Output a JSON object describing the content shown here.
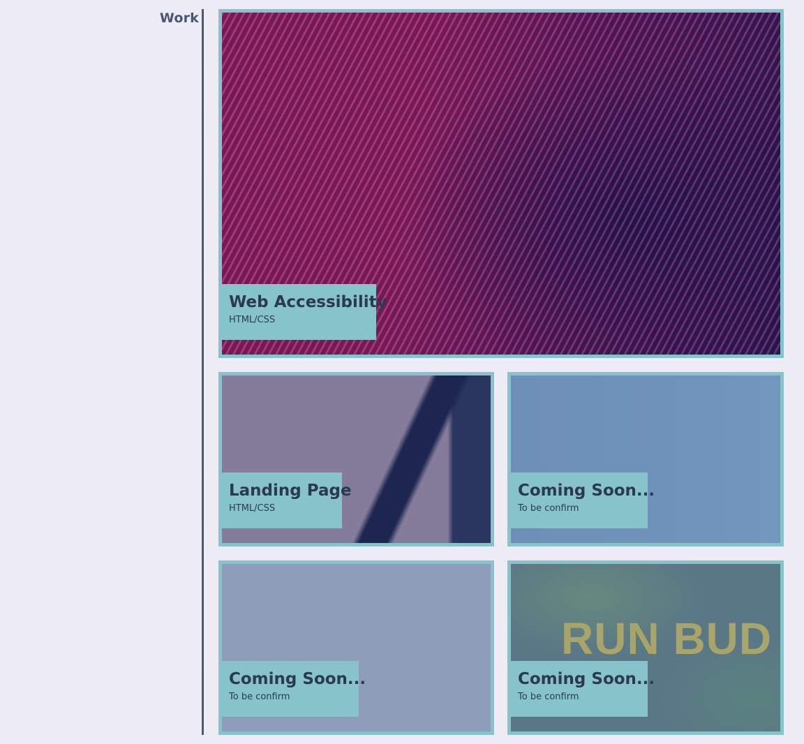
{
  "section": {
    "label": "Work"
  },
  "projects": [
    {
      "title": "Web Accessibility",
      "subtitle": "HTML/CSS"
    },
    {
      "title": "Landing Page",
      "subtitle": "HTML/CSS"
    },
    {
      "title": "Coming Soon...",
      "subtitle": "To be confirm"
    },
    {
      "title": "Coming Soon...",
      "subtitle": "To be confirm"
    },
    {
      "title": "Coming Soon...",
      "subtitle": "To be confirm",
      "image_text": "RUN BUD"
    }
  ],
  "colors": {
    "background": "#edecf5",
    "accent": "#87c3cb",
    "text": "#2c3a4f",
    "timeline": "#4c5875"
  }
}
